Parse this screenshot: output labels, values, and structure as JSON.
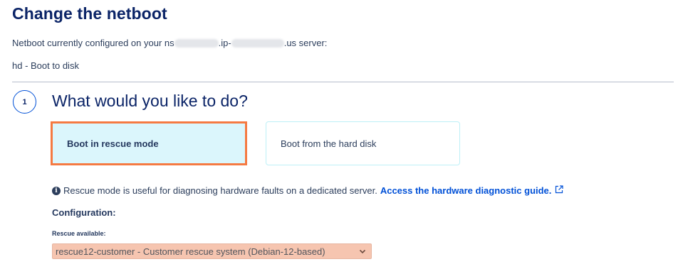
{
  "page": {
    "title": "Change the netboot"
  },
  "current_config": {
    "prefix": "Netboot currently configured on your ns",
    "mid": ".ip-",
    "suffix": ".us server:",
    "value": "hd - Boot to disk"
  },
  "step": {
    "number": "1",
    "title": "What would you like to do?"
  },
  "choices": [
    {
      "label": "Boot in rescue mode",
      "selected": true
    },
    {
      "label": "Boot from the hard disk",
      "selected": false
    }
  ],
  "info": {
    "text": "Rescue mode is useful for diagnosing hardware faults on a dedicated server.",
    "link_label": "Access the hardware diagnostic guide."
  },
  "configuration": {
    "heading": "Configuration:",
    "rescue_label": "Rescue available:",
    "rescue_selected": "rescue12-customer - Customer rescue system (Debian-12-based)"
  },
  "colors": {
    "title": "#0b2467",
    "accent_link": "#0050d7",
    "highlight_border": "#f57a42",
    "selected_bg": "#dbf6fc",
    "select_bg": "#f6c5b0"
  },
  "icons": {
    "info": "info-circle-icon",
    "external": "external-link-icon",
    "select": "chevron-down-icon"
  }
}
